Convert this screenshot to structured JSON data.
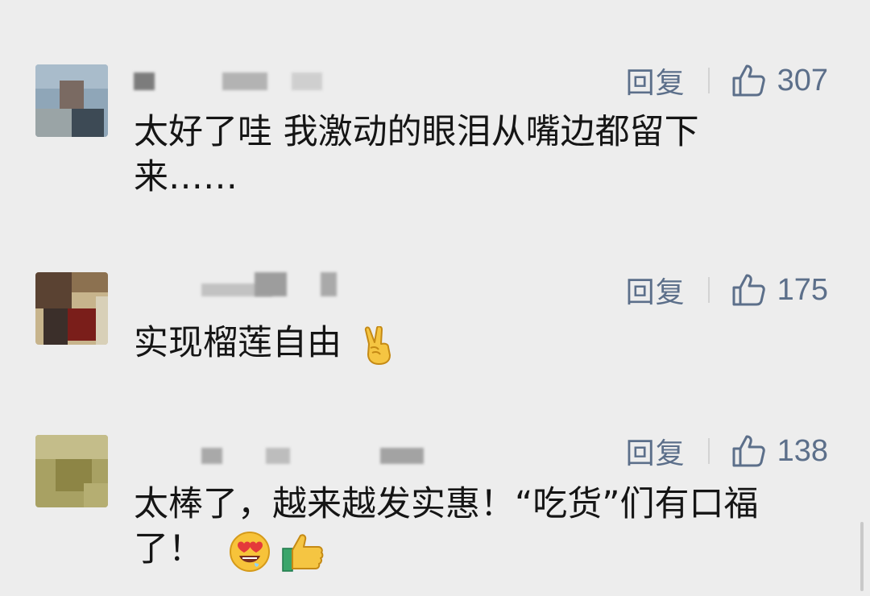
{
  "comments": [
    {
      "reply_label": "回复",
      "like_count": "307",
      "text_lines": [
        "太好了哇 我激动的眼泪从嘴边都留下",
        "来……"
      ],
      "emoji": []
    },
    {
      "reply_label": "回复",
      "like_count": "175",
      "text_lines": [
        "实现榴莲自由"
      ],
      "emoji": [
        "victory-hand"
      ]
    },
    {
      "reply_label": "回复",
      "like_count": "138",
      "text_lines": [
        "太棒了，越来越发实惠！“吃货”们有口福",
        "了！"
      ],
      "emoji": [
        "heart-eyes-drool",
        "thumbs-up"
      ]
    }
  ],
  "colors": {
    "background": "#ededed",
    "action_text": "#5c6f8a",
    "comment_text": "#151515"
  }
}
